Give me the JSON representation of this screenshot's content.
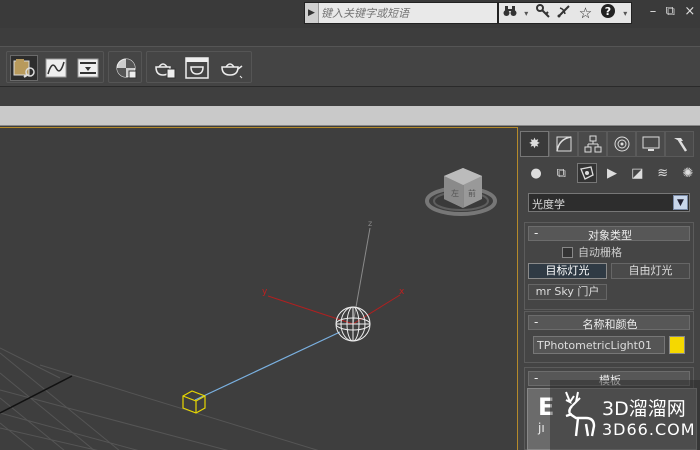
{
  "search": {
    "placeholder": "键入关键字或短语"
  },
  "info_bar": {
    "icons": [
      "binoculars-icon",
      "key-icon",
      "satellite-icon",
      "star-icon",
      "help-icon"
    ]
  },
  "window_controls": {
    "minimize": "–",
    "restore": "⧉",
    "close": "×"
  },
  "command_panel": {
    "category_dropdown": {
      "selected": "光度学"
    },
    "object_type": {
      "title": "对象类型",
      "auto_grid_label": "自动栅格",
      "auto_grid_checked": false,
      "buttons": [
        "目标灯光",
        "自由灯光",
        "mr Sky 门户"
      ],
      "active_button": "目标灯光"
    },
    "name_color": {
      "title": "名称和颜色",
      "object_name": "TPhotometricLight01",
      "color": "#f5d800"
    },
    "templates": {
      "title": "模板",
      "preview_text_1": "E",
      "preview_text_2": "jı"
    }
  },
  "viewport": {
    "axis_labels": {
      "x": "x",
      "y": "y",
      "z": "z"
    },
    "viewcube_labels": {
      "front": "前",
      "left": "左"
    }
  },
  "watermark": {
    "line1": "3D溜溜网",
    "line2": "3D66.COM"
  }
}
